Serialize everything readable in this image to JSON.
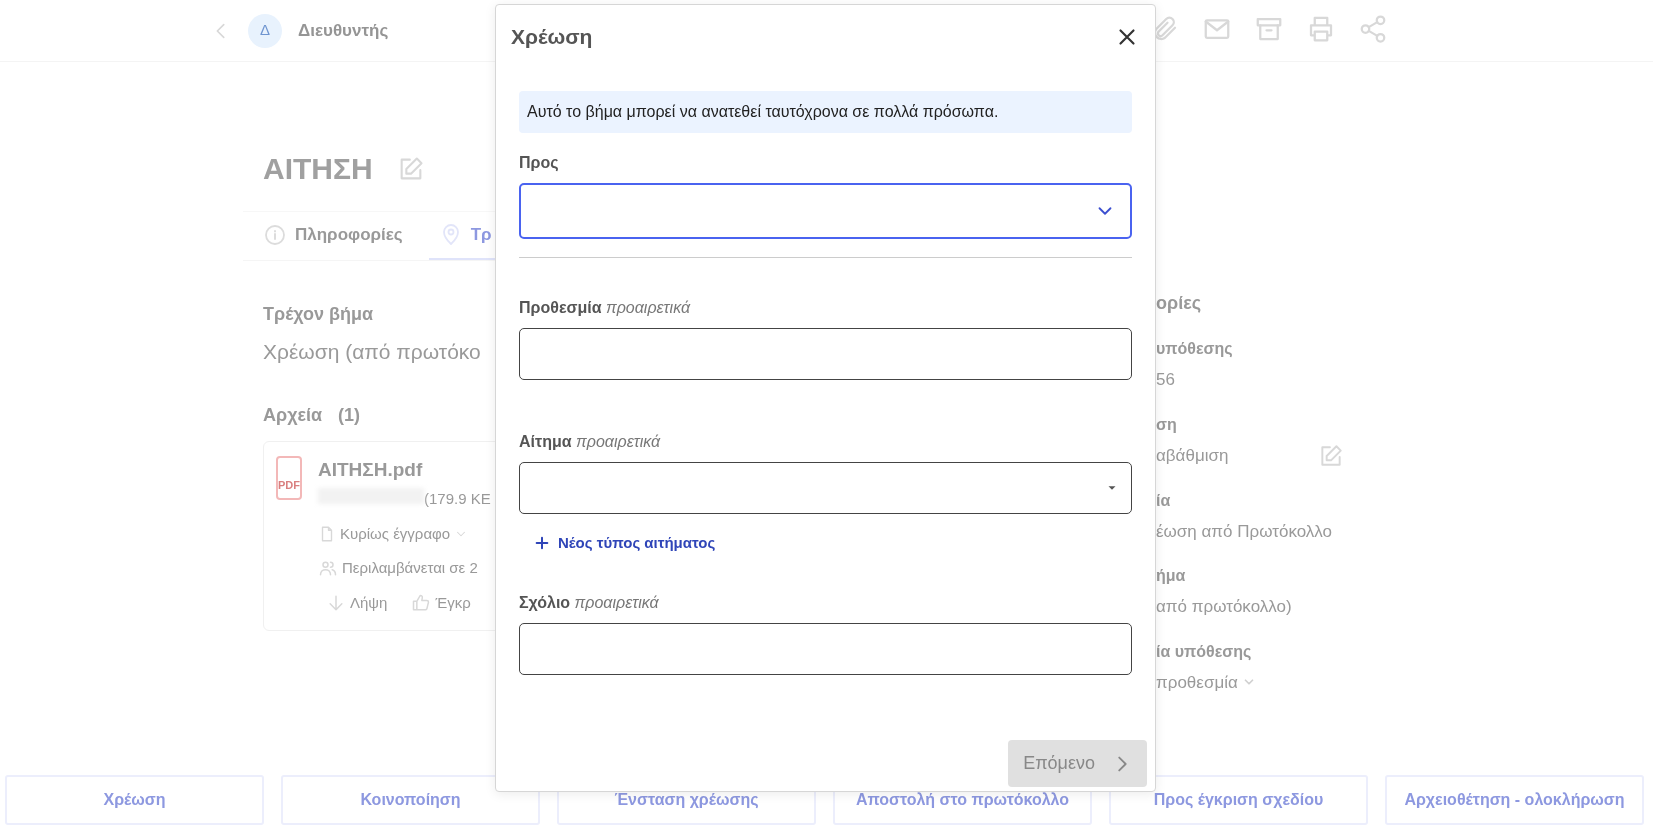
{
  "top_bar": {
    "user_initial": "Δ",
    "user_name": "Διευθυντής"
  },
  "document": {
    "title": "ΑΙΤΗΣΗ",
    "tabs": [
      {
        "label": "Πληροφορίες",
        "selected": false
      },
      {
        "label": "Τρ",
        "selected": true
      }
    ],
    "current_step_label": "Τρέχον βήμα",
    "current_step": "Χρέωση (από πρωτόκο",
    "files_label": "Αρχεία",
    "files_count": "(1)",
    "files": [
      {
        "icon_text": "PDF",
        "name": "ΑΙΤΗΣΗ.pdf",
        "size": "(179.9 KE",
        "type": "Κυρίως έγγραφο",
        "included": "Περιλαμβάνεται σε 2",
        "actions": [
          "Λήψη",
          "Έγκρ"
        ]
      }
    ]
  },
  "info_panel": {
    "heading": "ορίες",
    "fields": [
      {
        "kind": "text",
        "label": "υπόθεσης",
        "value": "56"
      },
      {
        "kind": "editable",
        "label": "ση",
        "value": "αβάθμιση"
      },
      {
        "kind": "text",
        "label": "ία",
        "value": "έωση από Πρωτόκολλο"
      },
      {
        "kind": "text",
        "label": "ήμα",
        "value": "από πρωτόκολλο)"
      },
      {
        "kind": "dropdown",
        "label": "ία υπόθεσης",
        "value": "προθεσμία"
      }
    ]
  },
  "actions": [
    "Χρέωση",
    "Κοινοποίηση",
    "Ένσταση χρέωσης",
    "Αποστολή στο πρωτόκολλο",
    "Προς έγκριση σχεδίου",
    "Αρχειοθέτηση - ολοκλήρωση"
  ],
  "dialog": {
    "title": "Χρέωση",
    "notice": "Αυτό το βήμα μπορεί να ανατεθεί ταυτόχρονα σε πολλά πρόσωπα.",
    "fields": [
      {
        "kind": "select",
        "label": "Προς",
        "focused": true
      },
      {
        "kind": "date",
        "label": "Προθεσμία",
        "hint": "προαιρετικά",
        "focused": false
      },
      {
        "kind": "dropdown",
        "label": "Αίτημα",
        "hint": "προαιρετικά",
        "focused": false,
        "link": "Νέος τύπος αιτήματος"
      },
      {
        "kind": "text",
        "label": "Σχόλιο",
        "hint": "προαιρετικά",
        "focused": false
      }
    ],
    "next_button": {
      "label": "Επόμενο",
      "disabled": true
    }
  }
}
